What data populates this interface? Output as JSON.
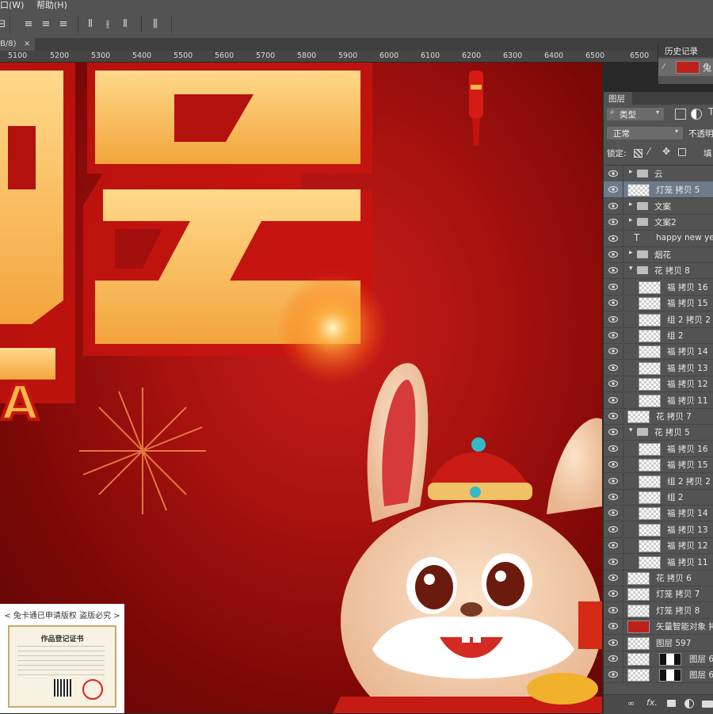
{
  "menubar": {
    "items": [
      "口(W)",
      "帮助(H)"
    ]
  },
  "document_tab": {
    "title": "B/8)",
    "close": "×"
  },
  "ruler": {
    "labels": [
      "5100",
      "5200",
      "5300",
      "5400",
      "5500",
      "5600",
      "5700",
      "5800",
      "5900",
      "6000",
      "6100",
      "6200",
      "6300",
      "6400",
      "6500",
      "6500"
    ]
  },
  "history_panel": {
    "title": "历史记录",
    "item": "兔"
  },
  "layers_panel": {
    "title": "图层",
    "filter_label": "类型",
    "blend_mode": "正常",
    "opacity_label": "不透明",
    "lock_label": "锁定:",
    "fill_label": "填",
    "layers": [
      {
        "name": "云",
        "kind": "group",
        "expanded": false,
        "indent": 0
      },
      {
        "name": "灯笼 拷贝 5",
        "kind": "layer",
        "indent": 0,
        "selected": true
      },
      {
        "name": "文案",
        "kind": "group",
        "expanded": false,
        "indent": 0
      },
      {
        "name": "文案2",
        "kind": "group",
        "expanded": false,
        "indent": 0
      },
      {
        "name": "happy new year",
        "kind": "text",
        "indent": 0
      },
      {
        "name": "烟花",
        "kind": "group",
        "expanded": false,
        "indent": 0
      },
      {
        "name": "花 拷贝 8",
        "kind": "group",
        "expanded": true,
        "indent": 0
      },
      {
        "name": "福 拷贝 16",
        "kind": "layer",
        "indent": 1
      },
      {
        "name": "福 拷贝 15",
        "kind": "layer",
        "indent": 1
      },
      {
        "name": "组 2 拷贝 2",
        "kind": "layer",
        "indent": 1
      },
      {
        "name": "组 2",
        "kind": "layer",
        "indent": 1
      },
      {
        "name": "福 拷贝 14",
        "kind": "layer",
        "indent": 1
      },
      {
        "name": "福 拷贝 13",
        "kind": "layer",
        "indent": 1
      },
      {
        "name": "福 拷贝 12",
        "kind": "layer",
        "indent": 1
      },
      {
        "name": "福 拷贝 11",
        "kind": "layer",
        "indent": 1
      },
      {
        "name": "花 拷贝 7",
        "kind": "layer",
        "indent": 0
      },
      {
        "name": "花 拷贝 5",
        "kind": "group",
        "expanded": true,
        "indent": 0
      },
      {
        "name": "福 拷贝 16",
        "kind": "layer",
        "indent": 1
      },
      {
        "name": "福 拷贝 15",
        "kind": "layer",
        "indent": 1
      },
      {
        "name": "组 2 拷贝 2",
        "kind": "layer",
        "indent": 1
      },
      {
        "name": "组 2",
        "kind": "layer",
        "indent": 1
      },
      {
        "name": "福 拷贝 14",
        "kind": "layer",
        "indent": 1
      },
      {
        "name": "福 拷贝 13",
        "kind": "layer",
        "indent": 1
      },
      {
        "name": "福 拷贝 12",
        "kind": "layer",
        "indent": 1
      },
      {
        "name": "福 拷贝 11",
        "kind": "layer",
        "indent": 1
      },
      {
        "name": "花 拷贝 6",
        "kind": "layer",
        "indent": 0
      },
      {
        "name": "灯笼 拷贝 7",
        "kind": "layer",
        "indent": 0
      },
      {
        "name": "灯笼 拷贝 8",
        "kind": "layer",
        "indent": 0
      },
      {
        "name": "矢量智能对象 拷",
        "kind": "smart",
        "indent": 0
      },
      {
        "name": "图层 597",
        "kind": "layer",
        "indent": 0
      },
      {
        "name": "图层 6",
        "kind": "masked",
        "indent": 0
      },
      {
        "name": "图层 6",
        "kind": "masked",
        "indent": 0
      }
    ],
    "footer_icons": [
      "link-icon",
      "fx-icon",
      "mask-icon",
      "adjustment-icon",
      "folder-icon"
    ]
  },
  "canvas_art": {
    "big_letter": "A"
  },
  "watermark": {
    "text": "< 兔卡通已申请版权 盗版必究 >",
    "certificate_title": "作品登记证书"
  },
  "colors": {
    "canvas_red": "#a9120f",
    "gold": "#f6b64a",
    "panel_bg": "#535353",
    "selection": "#6d7a8a"
  }
}
